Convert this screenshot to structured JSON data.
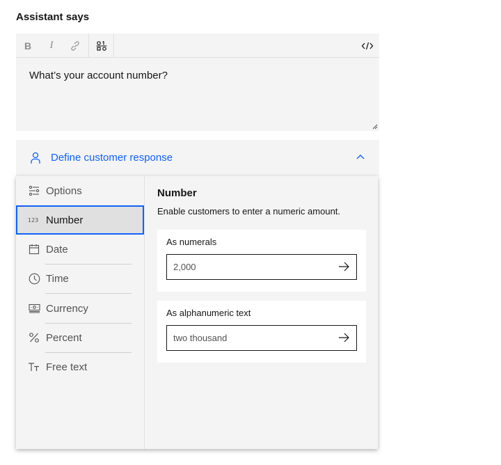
{
  "heading": "Assistant says",
  "editor": {
    "toolbar": {
      "bold": "B",
      "italic": "I",
      "link_icon": "link-icon",
      "variable_icon": "variable-icon",
      "code_icon": "code-icon"
    },
    "text": "What’s your account number?"
  },
  "define_response": {
    "label": "Define customer response",
    "icon": "person-icon",
    "chevron": "chevron-up-icon",
    "accent": "#0f62fe"
  },
  "menu": {
    "items": [
      {
        "label": "Options",
        "icon": "options-icon"
      },
      {
        "label": "Number",
        "icon": "number-icon",
        "selected": true
      },
      {
        "label": "Date",
        "icon": "calendar-icon"
      },
      {
        "label": "Time",
        "icon": "clock-icon"
      },
      {
        "label": "Currency",
        "icon": "currency-icon"
      },
      {
        "label": "Percent",
        "icon": "percent-icon"
      },
      {
        "label": "Free text",
        "icon": "text-icon"
      }
    ]
  },
  "detail": {
    "title": "Number",
    "description": "Enable customers to enter a numeric amount.",
    "cards": [
      {
        "label": "As numerals",
        "value": "2,000"
      },
      {
        "label": "As alphanumeric text",
        "value": "two thousand"
      }
    ]
  }
}
